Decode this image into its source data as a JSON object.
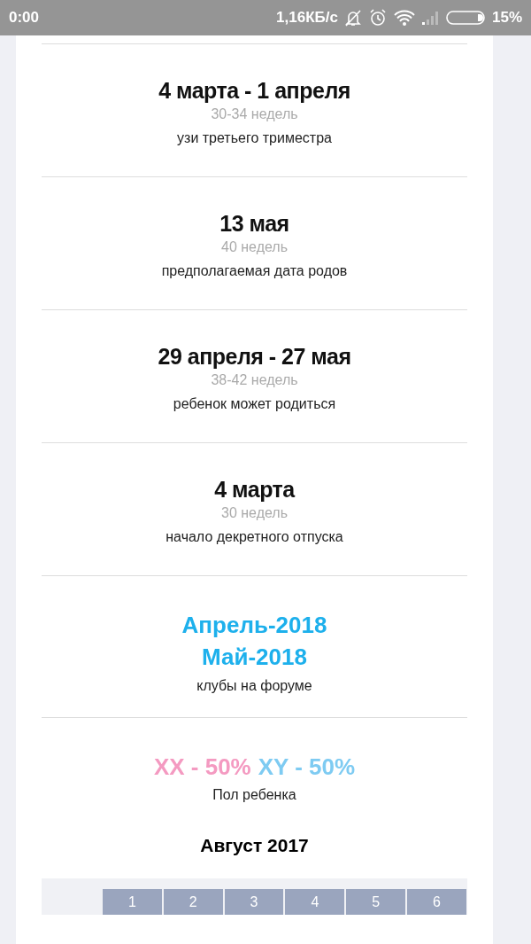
{
  "status_bar": {
    "time": "0:00",
    "speed": "1,16КБ/с",
    "battery": "15%"
  },
  "events": [
    {
      "kind": "date",
      "title": "4 марта - 1 апреля",
      "weeks": "30-34 недель",
      "description": "узи третьего триместра"
    },
    {
      "kind": "date",
      "title": "13 мая",
      "weeks": "40 недель",
      "description": "предполагаемая дата родов"
    },
    {
      "kind": "date",
      "title": "29 апреля - 27 мая",
      "weeks": "38-42 недель",
      "description": "ребенок может родиться"
    },
    {
      "kind": "date",
      "title": "4 марта",
      "weeks": "30 недель",
      "description": "начало декретного отпуска"
    },
    {
      "kind": "links",
      "links": [
        "Апрель-2018",
        "Май-2018"
      ],
      "description": "клубы на форуме"
    },
    {
      "kind": "sex",
      "parts": [
        {
          "text": "XX - 50%",
          "color": "#f49ac1"
        },
        {
          "text": "XY - 50%",
          "color": "#7ecbf2"
        }
      ],
      "description": "Пол ребенка"
    }
  ],
  "calendar": {
    "title": "Август 2017",
    "weeks": [
      "1",
      "2",
      "3",
      "4",
      "5",
      "6"
    ]
  }
}
